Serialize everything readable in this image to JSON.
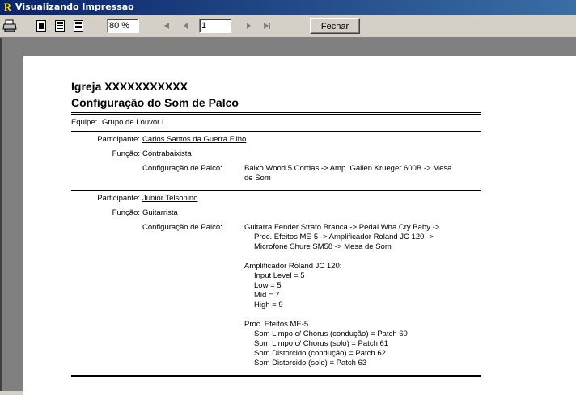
{
  "window": {
    "title": "Visualizando Impressao",
    "app_icon_letter": "R"
  },
  "toolbar": {
    "zoom_value": "80 %",
    "page_value": "1",
    "close_label": "Fechar"
  },
  "report": {
    "church": "Igreja XXXXXXXXXXX",
    "heading": "Configuração do Som de Palco",
    "team_label": "Equipe:",
    "team_value": "Grupo de Louvor I",
    "participant_label": "Participante:",
    "function_label": "Função:",
    "config_label": "Configuração de Palco:",
    "participants": [
      {
        "name": "Carlos Santos da Guerra Filho",
        "function": "Contrabaixista",
        "config_lines": [
          "Baixo Wood 5 Cordas -> Amp. Gallen Krueger 600B -> Mesa de",
          "de Som"
        ]
      },
      {
        "name": "Junior Telsonino",
        "function": "Guitarrista",
        "config_lines": [
          "Guitarra Fender Strato Branca -> Pedal Wha Cry Baby ->",
          "Proc. Efeitos ME-5 -> Amplificador Roland JC 120 ->",
          "Microfone Shure SM58 -> Mesa de Som",
          "Amplificador Roland JC 120:",
          "Input Level = 5",
          "Low = 5",
          "Mid = 7",
          "High = 9",
          "Proc. Efeitos ME-5",
          "Som Limpo c/ Chorus (condução) = Patch 60",
          "Som Limpo c/ Chorus (solo) = Patch 61",
          "Som Distorcido (condução) = Patch 62",
          "Som Distorcido (solo) = Patch 63"
        ]
      }
    ]
  }
}
